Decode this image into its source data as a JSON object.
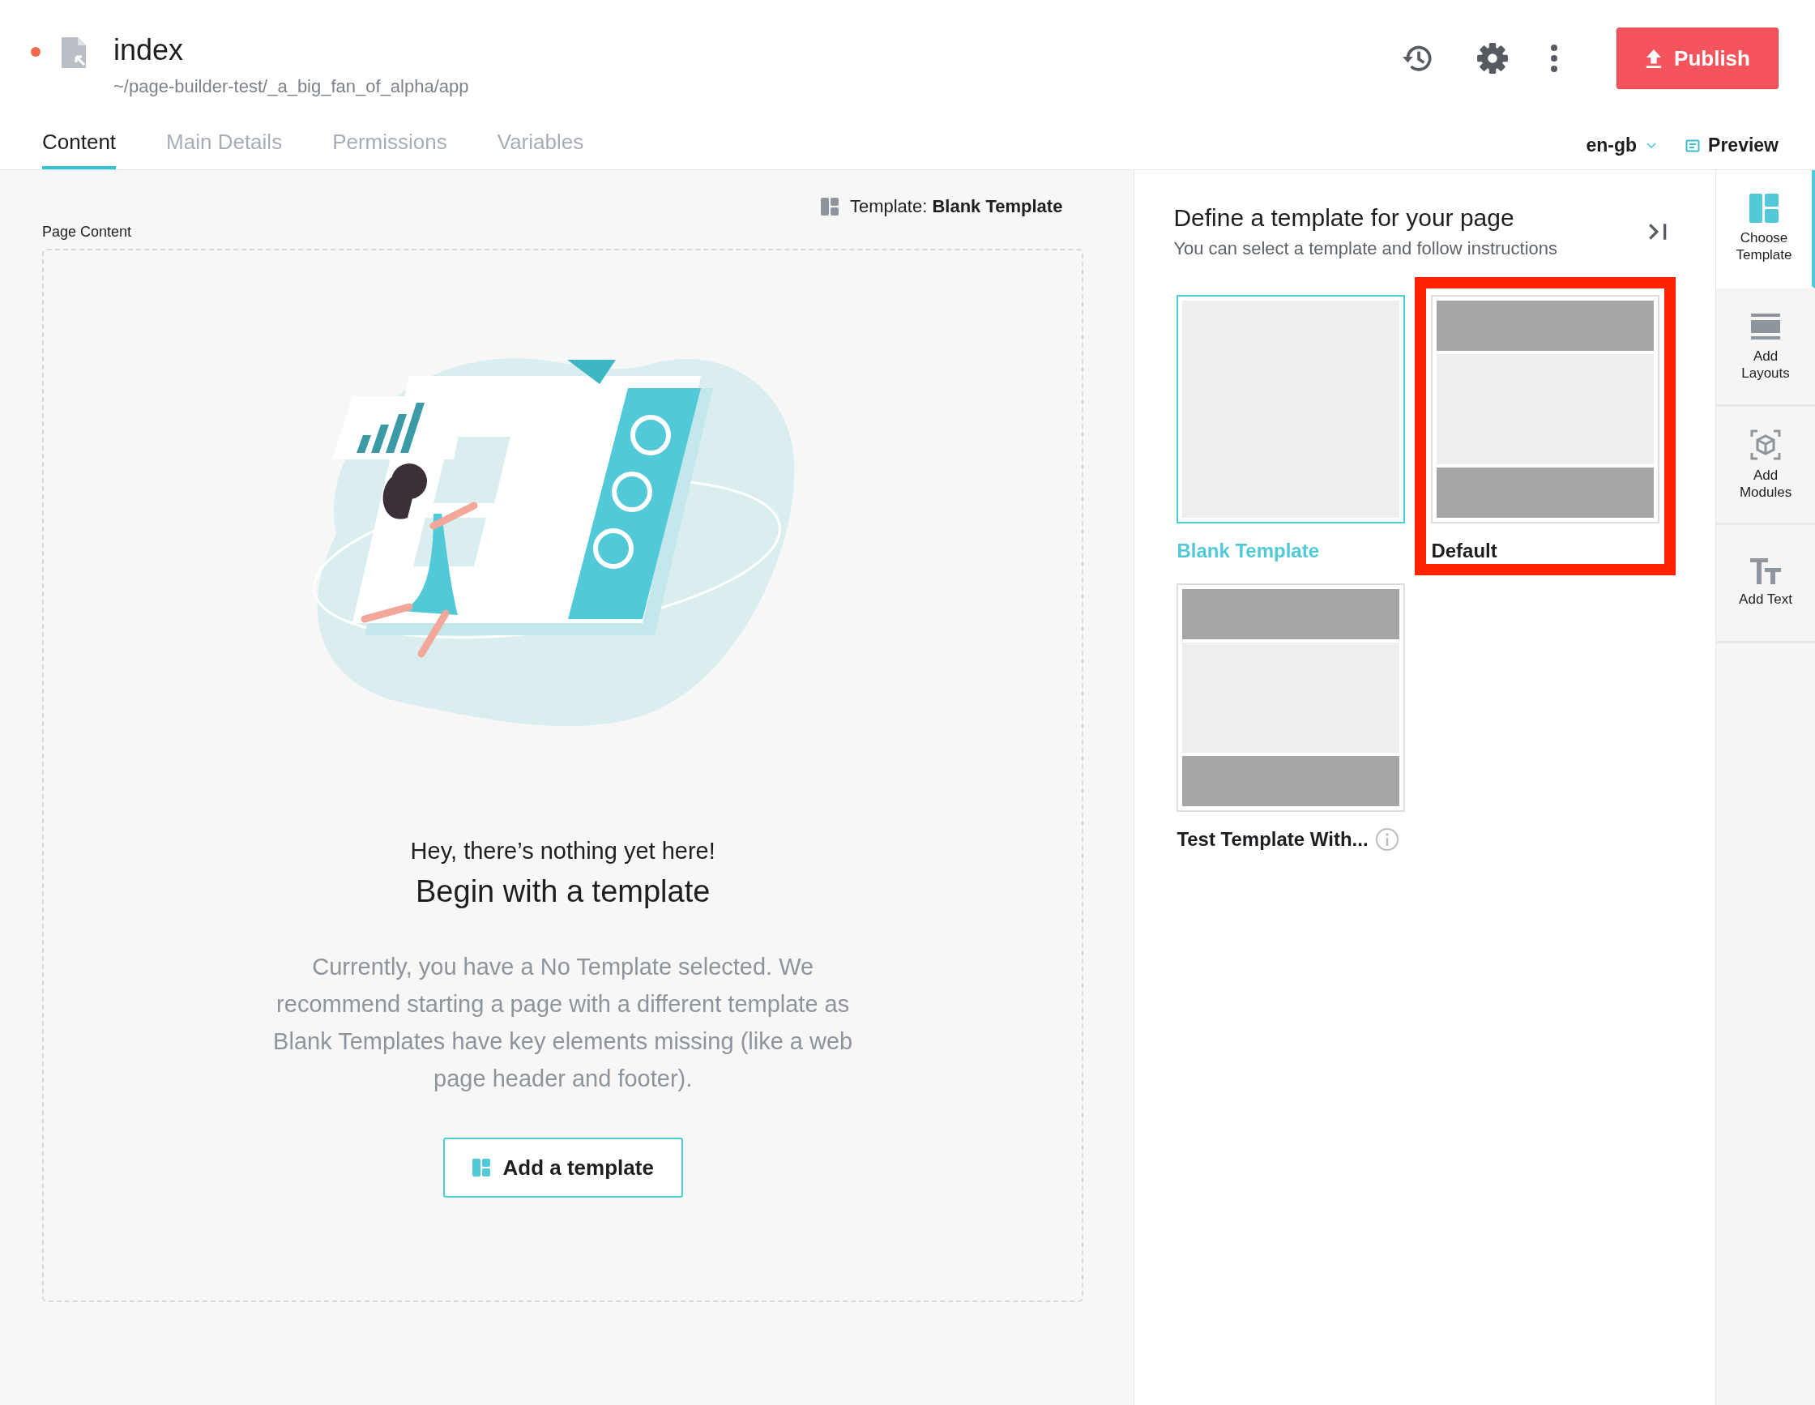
{
  "document": {
    "unsaved": true,
    "title": "index",
    "path": "~/page-builder-test/_a_big_fan_of_alpha/app"
  },
  "toolbar": {
    "publish": "Publish"
  },
  "tabs": [
    {
      "label": "Content",
      "selected": true
    },
    {
      "label": "Main Details",
      "selected": false
    },
    {
      "label": "Permissions",
      "selected": false
    },
    {
      "label": "Variables",
      "selected": false
    }
  ],
  "locale": "en-gb",
  "preview": "Preview",
  "content": {
    "template_label": "Template:",
    "template_name": "Blank Template",
    "section_label": "Page Content",
    "heading": "Hey, there’s nothing yet here!",
    "title": "Begin with a template",
    "message": "Currently, you have a No Template selected. We recommend starting a page with a different template as Blank Templates have key elements missing (like a web page header and footer).",
    "button": "Add a template"
  },
  "panel": {
    "title": "Define a template for your page",
    "subtitle": "You can select a template and follow instructions",
    "templates": [
      {
        "name": "Blank Template",
        "kind": "blank",
        "selected": true,
        "highlighted": false,
        "info": false
      },
      {
        "name": "Default",
        "kind": "header_footer",
        "selected": false,
        "highlighted": true,
        "info": false
      },
      {
        "name": "Test Template With...",
        "kind": "header_footer",
        "selected": false,
        "highlighted": false,
        "info": true
      }
    ]
  },
  "sidebar": {
    "items": [
      {
        "label": "Choose Template",
        "kind": "template",
        "selected": true
      },
      {
        "label": "Add Layouts",
        "kind": "layouts",
        "selected": false
      },
      {
        "label": "Add Modules",
        "kind": "modules",
        "selected": false
      },
      {
        "label": "Add Text",
        "kind": "text",
        "selected": false
      }
    ]
  }
}
